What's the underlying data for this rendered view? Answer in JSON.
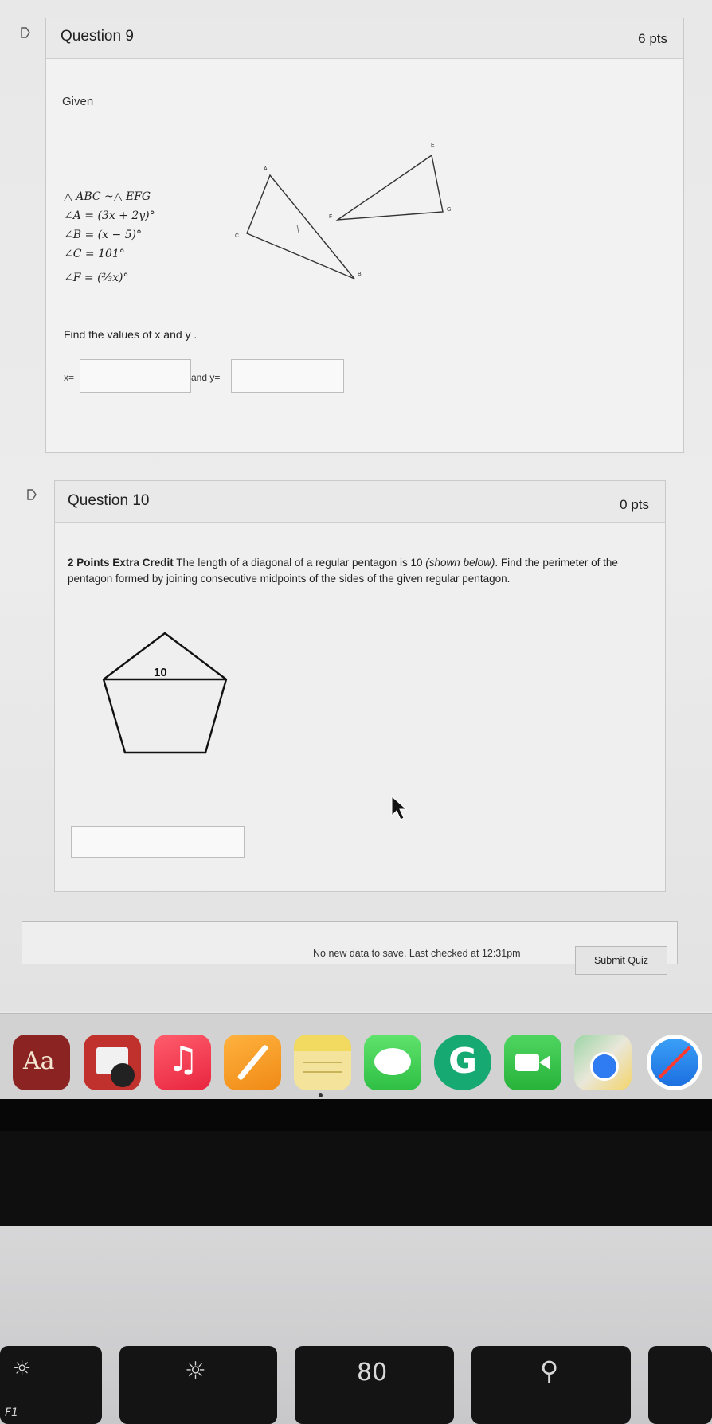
{
  "question9": {
    "title": "Question 9",
    "points": "6 pts",
    "given_label": "Given",
    "givens": [
      "△ ABC ~△ EFG",
      "∠A = (3x + 2y)°",
      "∠B = (x − 5)°",
      "∠C = 101°",
      "∠F = (⅔x)°"
    ],
    "prompt": "Find the values of x and y .",
    "x_label": "x=",
    "y_label": "and y=",
    "x_value": "",
    "y_value": "",
    "figure_labels": {
      "A": "A",
      "B": "B",
      "C": "C",
      "E": "E",
      "F": "F",
      "G": "G"
    }
  },
  "question10": {
    "title": "Question 10",
    "points": "0 pts",
    "text_bold": "2 Points Extra Credit",
    "text_main": " The length of a diagonal of a regular pentagon is 10 ",
    "text_italic": "(shown below)",
    "text_rest": ". Find the perimeter of the pentagon formed by joining consecutive midpoints of the sides of the given regular pentagon.",
    "diagonal_label": "10",
    "answer_value": ""
  },
  "footer": {
    "save_message": "No new data to save. Last checked at 12:31pm",
    "submit_label": "Submit Quiz"
  },
  "dock": {
    "dictionary_label": "Aa",
    "apps": [
      "dictionary",
      "photo-booth",
      "music",
      "pages",
      "notes",
      "messages",
      "grammarly",
      "facetime",
      "maps",
      "safari"
    ]
  },
  "keyboard": {
    "f1_label": "F1",
    "mission_label": "80"
  }
}
